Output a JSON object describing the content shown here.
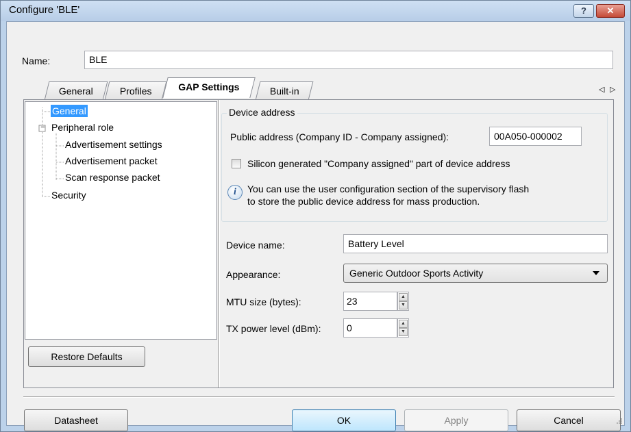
{
  "window": {
    "title": "Configure 'BLE'",
    "help_label": "?",
    "close_label": "✕"
  },
  "name_label": "Name:",
  "name_value": "BLE",
  "tabs": [
    {
      "label": "General"
    },
    {
      "label": "Profiles"
    },
    {
      "label": "GAP Settings"
    },
    {
      "label": "Built-in"
    }
  ],
  "tab_scroll": {
    "left": "◁",
    "right": "▷"
  },
  "tree": {
    "general": "General",
    "peripheral": "Peripheral role",
    "advertisement_settings": "Advertisement settings",
    "advertisement_packet": "Advertisement packet",
    "scan_response": "Scan response packet",
    "security": "Security",
    "expander": "−"
  },
  "restore_defaults": "Restore Defaults",
  "device_address": {
    "legend": "Device address",
    "public_label": "Public address (Company ID - Company assigned):",
    "public_value": "00A050-000002",
    "checkbox_label": "Silicon generated \"Company assigned\" part of device address",
    "checked": false,
    "info_icon": "i",
    "info_text_1": "You can use the user configuration section of the supervisory flash",
    "info_text_2": "to store the public device address for mass production."
  },
  "device_name": {
    "label": "Device name:",
    "value": "Battery Level"
  },
  "appearance": {
    "label": "Appearance:",
    "value": "Generic Outdoor Sports Activity"
  },
  "mtu": {
    "label": "MTU size (bytes):",
    "value": "23"
  },
  "tx_power": {
    "label": "TX power level (dBm):",
    "value": "0"
  },
  "buttons": {
    "datasheet": "Datasheet",
    "ok": "OK",
    "apply": "Apply",
    "cancel": "Cancel"
  },
  "colors": {
    "selected": "#3399ff",
    "accent": "#3c7fb1"
  }
}
